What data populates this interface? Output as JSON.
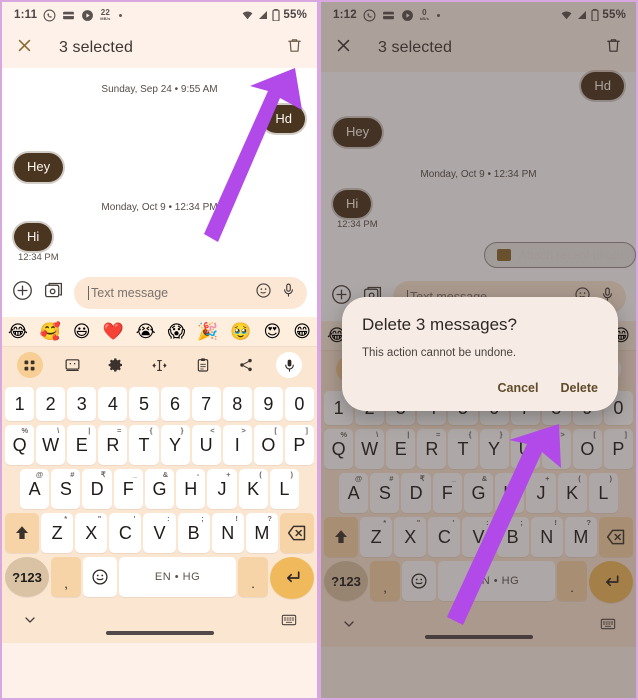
{
  "panels": [
    {
      "id": "left",
      "status": {
        "time": "1:11",
        "icons": [
          "whatsapp-icon",
          "wallet-icon",
          "play-icon",
          "data-usage-icon",
          "more-dot-icon"
        ],
        "data_usage": "22",
        "data_usage_unit": "MB/s",
        "wifi": "wifi-icon",
        "signal": "signal-icon",
        "battery_icon": "battery-icon",
        "battery": "55%"
      },
      "actionbar": {
        "close": "close-icon",
        "title": "3 selected",
        "delete": "trash-icon"
      },
      "conversation": {
        "date1": "Sunday, Sep 24 • 9:55 AM",
        "date2": "Monday, Oct 9 • 12:34 PM",
        "messages": [
          {
            "text": "Hd",
            "side": "out",
            "time": ""
          },
          {
            "text": "Hey",
            "side": "in",
            "time": ""
          },
          {
            "text": "Hi",
            "side": "in",
            "time": "12:34 PM"
          }
        ]
      },
      "composer": {
        "add": "plus-circle-icon",
        "gallery": "gallery-icon",
        "placeholder": "Text message",
        "emoji": "emoji-icon",
        "mic": "mic-icon"
      },
      "dialog": null
    },
    {
      "id": "right",
      "status": {
        "time": "1:12",
        "icons": [
          "whatsapp-icon",
          "wallet-icon",
          "play-icon",
          "data-usage-icon",
          "more-dot-icon"
        ],
        "data_usage": "0",
        "data_usage_unit": "kB/s",
        "wifi": "wifi-icon",
        "signal": "signal-icon",
        "battery_icon": "battery-icon",
        "battery": "55%"
      },
      "actionbar": {
        "close": "close-icon",
        "title": "3 selected",
        "delete": "trash-icon"
      },
      "conversation": {
        "date1": "",
        "date2": "Monday, Oct 9 • 12:34 PM",
        "messages": [
          {
            "text": "Hd",
            "side": "out",
            "time": ""
          },
          {
            "text": "Hey",
            "side": "in",
            "time": ""
          },
          {
            "text": "Hi",
            "side": "in",
            "time": "12:34 PM"
          }
        ],
        "suggestion_chip": "Attach recent photo"
      },
      "composer": {
        "add": "plus-circle-icon",
        "gallery": "gallery-icon",
        "placeholder": "Text message",
        "emoji": "emoji-icon",
        "mic": "mic-icon"
      },
      "dialog": {
        "title": "Delete 3 messages?",
        "body": "This action cannot be undone.",
        "cancel": "Cancel",
        "confirm": "Delete"
      }
    }
  ],
  "keyboard": {
    "emoji_suggestions": [
      "😂",
      "🥰",
      "😃",
      "❤️",
      "😭",
      "😱",
      "🎉",
      "🥹",
      "😍",
      "😁"
    ],
    "toolbar": [
      "apps-grid-icon",
      "sticker-icon",
      "gear-icon",
      "text-edit-icon",
      "clipboard-icon",
      "share-icon",
      "mic-icon"
    ],
    "number_row": [
      "1",
      "2",
      "3",
      "4",
      "5",
      "6",
      "7",
      "8",
      "9",
      "0"
    ],
    "row1": [
      {
        "k": "Q",
        "s": "%"
      },
      {
        "k": "W",
        "s": "\\"
      },
      {
        "k": "E",
        "s": "|"
      },
      {
        "k": "R",
        "s": "="
      },
      {
        "k": "T",
        "s": "{"
      },
      {
        "k": "Y",
        "s": "}"
      },
      {
        "k": "U",
        "s": "<"
      },
      {
        "k": "I",
        "s": ">"
      },
      {
        "k": "O",
        "s": "["
      },
      {
        "k": "P",
        "s": "]"
      }
    ],
    "row2": [
      {
        "k": "A",
        "s": "@"
      },
      {
        "k": "S",
        "s": "#"
      },
      {
        "k": "D",
        "s": "₹"
      },
      {
        "k": "F",
        "s": "_"
      },
      {
        "k": "G",
        "s": "&"
      },
      {
        "k": "H",
        "s": "-"
      },
      {
        "k": "J",
        "s": "+"
      },
      {
        "k": "K",
        "s": "("
      },
      {
        "k": "L",
        "s": ")"
      }
    ],
    "row3": [
      {
        "k": "Z",
        "s": "*"
      },
      {
        "k": "X",
        "s": "\""
      },
      {
        "k": "C",
        "s": "'"
      },
      {
        "k": "V",
        "s": ":"
      },
      {
        "k": "B",
        "s": ";"
      },
      {
        "k": "N",
        "s": "!"
      },
      {
        "k": "M",
        "s": "?"
      }
    ],
    "shift": "shift-icon",
    "backspace": "backspace-icon",
    "symbols": "?123",
    "comma": ",",
    "emoji_key": "emoji-icon",
    "space_label": "EN • HG",
    "period": ".",
    "enter": "enter-icon",
    "hide_keyboard": "chevron-down-icon",
    "switch_keyboard": "keyboard-icon"
  },
  "colors": {
    "bubble": "#4a3520",
    "keyboard_bg": "#fbe6d2",
    "accent_enter": "#f0b95c",
    "panel_bg": "#fdf1e9",
    "arrow": "#b14ae8",
    "frame": "#d9a8e0"
  }
}
